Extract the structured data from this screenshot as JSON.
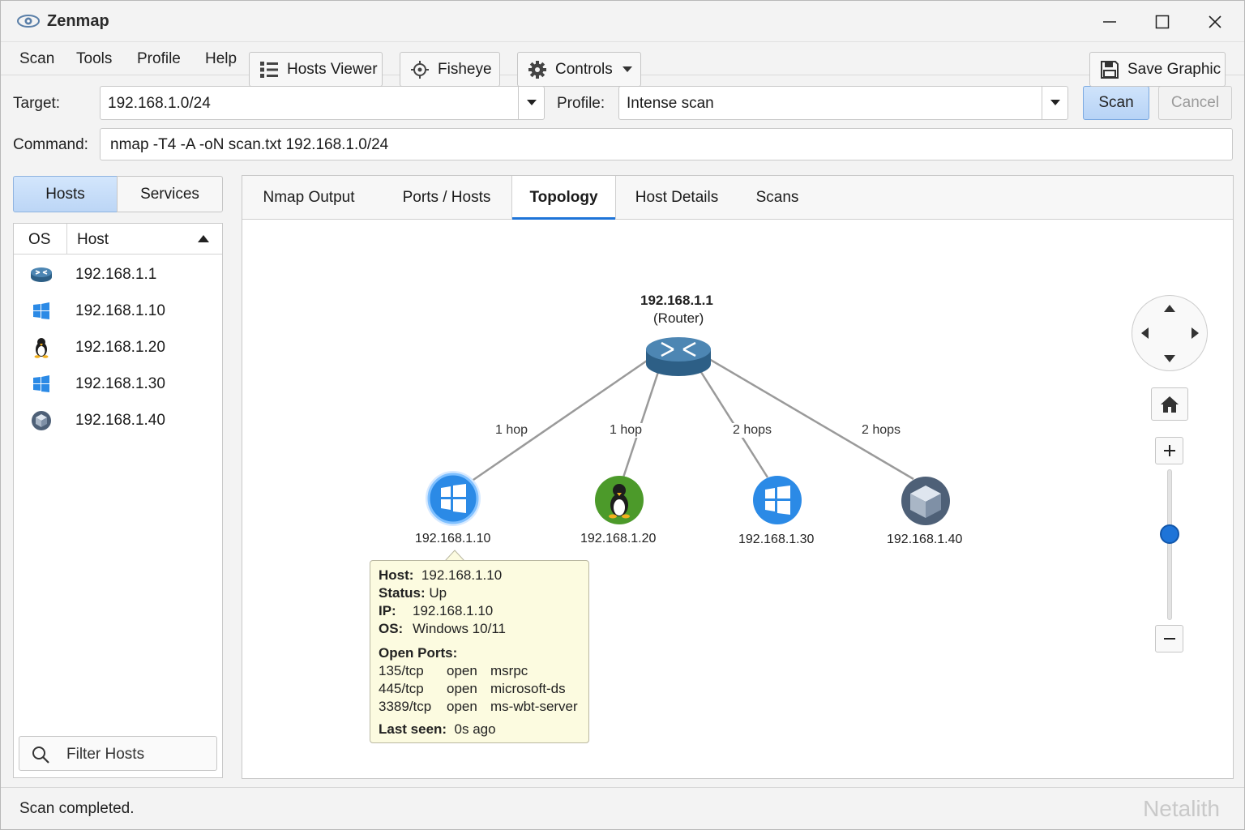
{
  "window": {
    "title": "Zenmap"
  },
  "menu": [
    "Scan",
    "Tools",
    "Profile",
    "Help"
  ],
  "target": {
    "label": "Target:",
    "value": "192.168.1.0/24"
  },
  "profile": {
    "label": "Profile:",
    "value": "Intense scan"
  },
  "buttons": {
    "scan": "Scan",
    "cancel": "Cancel"
  },
  "command": {
    "label": "Command:",
    "value": "nmap -T4 -A -oN scan.txt 192.168.1.0/24"
  },
  "left": {
    "toggle": [
      "Hosts",
      "Services"
    ],
    "columns": {
      "os": "OS",
      "host": "Host"
    },
    "hosts": [
      {
        "os_icon": "router-icon",
        "ip": "192.168.1.1"
      },
      {
        "os_icon": "windows-icon",
        "ip": "192.168.1.10"
      },
      {
        "os_icon": "linux-icon",
        "ip": "192.168.1.20"
      },
      {
        "os_icon": "windows-icon",
        "ip": "192.168.1.30"
      },
      {
        "os_icon": "unknown-os-icon",
        "ip": "192.168.1.40"
      }
    ],
    "filter": "Filter Hosts"
  },
  "tabs": [
    "Nmap Output",
    "Ports / Hosts",
    "Topology",
    "Host Details",
    "Scans"
  ],
  "active_tab": "Topology",
  "toolbar": {
    "hosts_viewer": "Hosts Viewer",
    "fisheye": "Fisheye",
    "controls": "Controls",
    "save_graphic": "Save Graphic"
  },
  "topology": {
    "router": {
      "ip": "192.168.1.1",
      "role": "(Router)"
    },
    "nodes": [
      {
        "ip": "192.168.1.10",
        "hops": "1 hop",
        "os": "windows"
      },
      {
        "ip": "192.168.1.20",
        "hops": "1 hop",
        "os": "linux"
      },
      {
        "ip": "192.168.1.30",
        "hops": "2 hops",
        "os": "windows"
      },
      {
        "ip": "192.168.1.40",
        "hops": "2 hops",
        "os": "unknown"
      }
    ]
  },
  "tooltip": {
    "host_label": "Host:",
    "host": "192.168.1.10",
    "status_label": "Status:",
    "status": "Up",
    "ip_label": "IP:",
    "ip": "192.168.1.10",
    "os_label": "OS:",
    "os": "Windows 10/11",
    "ports_label": "Open Ports:",
    "ports": [
      {
        "port": "135/tcp",
        "state": "open",
        "service": "msrpc"
      },
      {
        "port": "445/tcp",
        "state": "open",
        "service": "microsoft-ds"
      },
      {
        "port": "3389/tcp",
        "state": "open",
        "service": "ms-wbt-server"
      }
    ],
    "last_seen_label": "Last seen:",
    "last_seen": "0s ago"
  },
  "status": "Scan completed.",
  "watermark": "Netalith",
  "colors": {
    "accent": "#1e74d8",
    "tooltip_bg": "#fcfbe0",
    "router": "#3a7199",
    "linux": "#4c9a2a",
    "windows": "#2b8ae6",
    "unknown": "#5b6f86"
  }
}
